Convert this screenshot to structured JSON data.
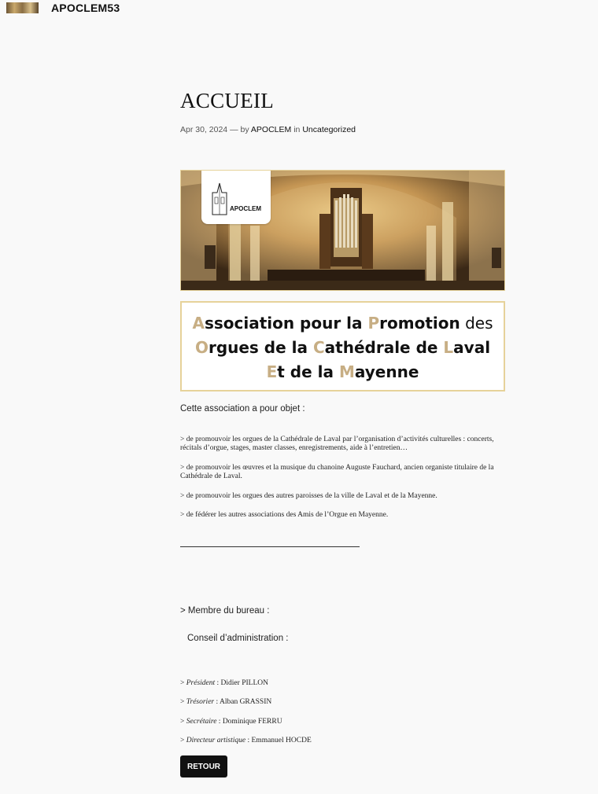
{
  "site": {
    "title": "APOCLEM53"
  },
  "post": {
    "title": "ACCUEIL",
    "date": "Apr 30, 2024",
    "sep": "—",
    "by": "by",
    "author": "APOCLEM",
    "in": "in",
    "category": "Uncategorized"
  },
  "banner": {
    "badge_text": "APOCLEM"
  },
  "association": {
    "l1": [
      {
        "t": "A",
        "g": true
      },
      {
        "t": "ssociation pour la ",
        "g": false
      },
      {
        "t": "P",
        "g": true
      },
      {
        "t": "romotion",
        "g": false
      },
      {
        "t": " des",
        "g": false,
        "light": true
      }
    ],
    "l2": [
      {
        "t": "O",
        "g": true
      },
      {
        "t": "rgues de la ",
        "g": false
      },
      {
        "t": "C",
        "g": true
      },
      {
        "t": "athédrale de ",
        "g": false
      },
      {
        "t": "L",
        "g": true
      },
      {
        "t": "aval",
        "g": false
      }
    ],
    "l3": [
      {
        "t": "E",
        "g": true
      },
      {
        "t": "t de la ",
        "g": false
      },
      {
        "t": "M",
        "g": true
      },
      {
        "t": "ayenne",
        "g": false
      }
    ]
  },
  "intro": "Cette association a pour objet :",
  "objectives": [
    "> de promouvoir les orgues de la Cathédrale de Laval par l’organisation d’activités culturelles : concerts, récitals d’orgue, stages, master classes, enregistrements, aide à l’entretien…",
    "> de promouvoir les œuvres et la musique du chanoine Auguste Fauchard, ancien organiste titulaire de la Cathédrale de Laval.",
    "> de promouvoir les orgues des autres paroisses de la ville de Laval et de la Mayenne.",
    "> de fédérer les autres associations des Amis de l’Orgue en Mayenne."
  ],
  "bureau_heading": "> Membre du bureau :",
  "conseil_heading": "Conseil d’administration :",
  "members": [
    {
      "prefix": ">",
      "role": "Président",
      "name": "Didier PILLON"
    },
    {
      "prefix": ">",
      "role": "Trésorier",
      "name": "Alban GRASSIN"
    },
    {
      "prefix": ">",
      "role": "Secrétaire",
      "name": "Dominique FERRU"
    },
    {
      "prefix": ">",
      "role": "Directeur artistique",
      "name": "Emmanuel HOCDE"
    }
  ],
  "retour_label": "RETOUR",
  "colors": {
    "gold": "#c7ae84",
    "border": "#e6d29a",
    "button": "#111111"
  }
}
